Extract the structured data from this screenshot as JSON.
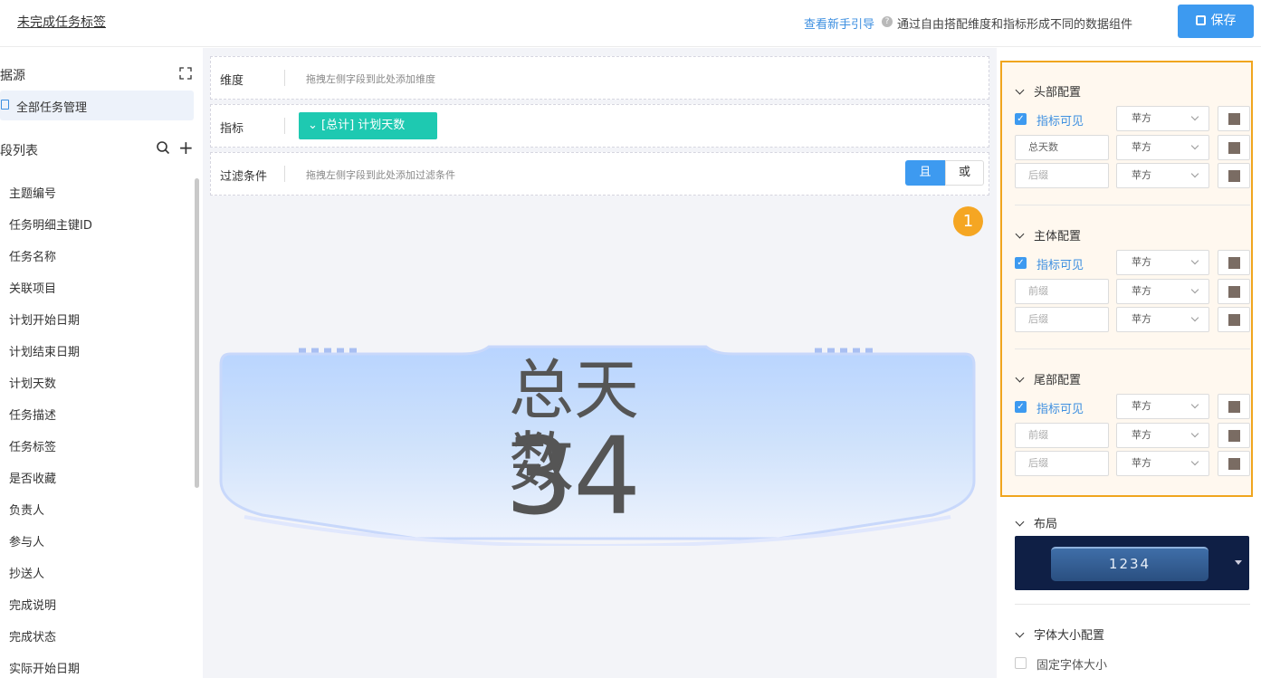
{
  "header": {
    "title": "未完成任务标签",
    "guide_link": "查看新手引导",
    "help_icon": "help-circle-icon",
    "hint": "通过自由搭配维度和指标形成不同的数据组件",
    "save_label": "保存"
  },
  "left": {
    "datasource_title": "据源",
    "datasource_item": "全部任务管理",
    "field_list_title": "段列表",
    "fields": [
      "主题编号",
      "任务明细主键ID",
      "任务名称",
      "关联项目",
      "计划开始日期",
      "计划结束日期",
      "计划天数",
      "任务描述",
      "任务标签",
      "是否收藏",
      "负责人",
      "参与人",
      "抄送人",
      "完成说明",
      "完成状态",
      "实际开始日期"
    ]
  },
  "center": {
    "dimension_label": "维度",
    "dimension_placeholder": "拖拽左侧字段到此处添加维度",
    "metric_label": "指标",
    "metric_chip": "[总计] 计划天数",
    "filter_label": "过滤条件",
    "filter_placeholder": "拖拽左侧字段到此处添加过滤条件",
    "and_label": "且",
    "or_label": "或",
    "badge": "1",
    "card_title": "总天数",
    "card_value": "34"
  },
  "right": {
    "header_section": {
      "title": "头部配置",
      "visible_label": "指标可见",
      "font_value": "苹方",
      "prefix_value": "总天数",
      "suffix_placeholder": "后缀"
    },
    "body_section": {
      "title": "主体配置",
      "visible_label": "指标可见",
      "font_value": "苹方",
      "prefix_placeholder": "前缀",
      "suffix_placeholder": "后缀"
    },
    "footer_section": {
      "title": "尾部配置",
      "visible_label": "指标可见",
      "font_value": "苹方",
      "prefix_placeholder": "前缀",
      "suffix_placeholder": "后缀"
    },
    "layout_title": "布局",
    "layout_preview_value": "1234",
    "font_size_title": "字体大小配置",
    "fixed_font_label": "固定字体大小"
  },
  "colors": {
    "accent": "#3d9af0",
    "chip": "#1ec9b1",
    "highlight": "#f0a51e",
    "swatch": "#7a6c63"
  }
}
